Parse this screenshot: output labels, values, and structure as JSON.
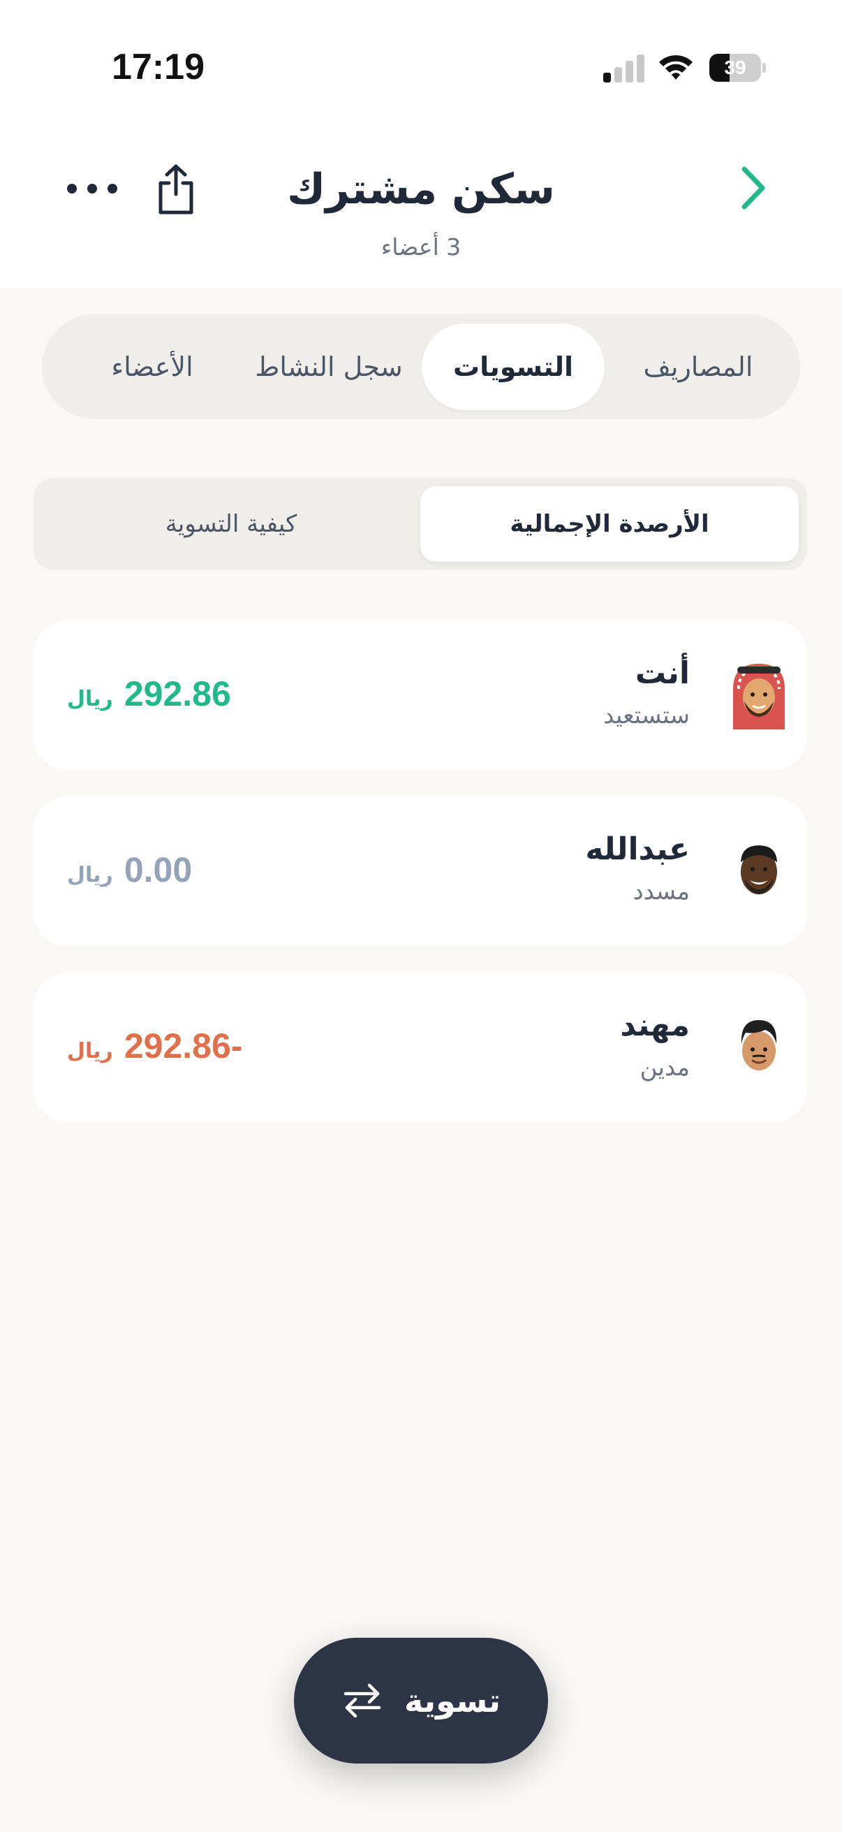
{
  "status_bar": {
    "time": "17:19",
    "battery": "39",
    "battery_level": 0.39
  },
  "header": {
    "title": "سكن مشترك",
    "subtitle": "3 أعضاء"
  },
  "tabs": [
    {
      "label": "المصاريف",
      "active": false
    },
    {
      "label": "التسويات",
      "active": true
    },
    {
      "label": "سجل النشاط",
      "active": false
    },
    {
      "label": "الأعضاء",
      "active": false
    }
  ],
  "segments": [
    {
      "label": "الأرصدة الإجمالية",
      "active": true
    },
    {
      "label": "كيفية التسوية",
      "active": false
    }
  ],
  "balances": [
    {
      "name": "أنت",
      "status": "ستستعيد",
      "amount": "292.86",
      "currency": "ريال",
      "color": "#22b98a",
      "avatar": "man-ghutra-avatar"
    },
    {
      "name": "عبدالله",
      "status": "مسدد",
      "amount": "0.00",
      "currency": "ريال",
      "color": "#94a3b8",
      "avatar": "man-avatar"
    },
    {
      "name": "مهند",
      "status": "مدين",
      "amount": "292.86-",
      "currency": "ريال",
      "color": "#e0704c",
      "avatar": "young-man-avatar"
    }
  ],
  "settle_button": {
    "label": "تسوية",
    "icon": "swap-arrows-icon"
  },
  "colors": {
    "accent": "#22b98a",
    "dark": "#2d3446",
    "positive": "#22b98a",
    "neutral": "#94a3b8",
    "negative": "#e0704c"
  }
}
